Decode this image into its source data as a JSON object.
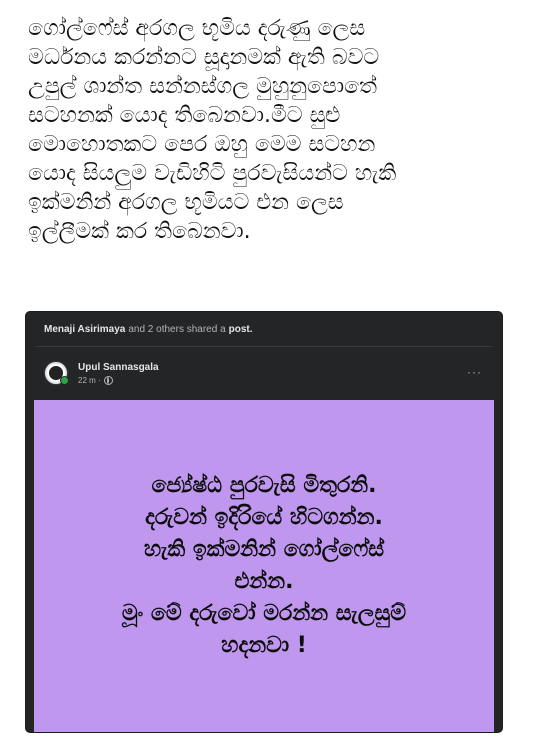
{
  "article": {
    "lines": [
      "ගෝල්ෆේස් අරගල භූමිය දරුණු ලෙස",
      "මර්ධනය කරන්නට සූදානමක් ඇති බවට",
      "උපුල් ශාන්ත සන්නස්ගල මුහුනුපොතේ",
      "සටහනක් යොද තිබෙනවා.මීට සුළු",
      "මොහොතකට පෙර ඔහු මෙම සටහන",
      "යොද සියලුම වැඩිහිටි පුරවැසියන්ට හැකි",
      "ඉක්මනින් අරගල භූමියට එන ලෙස",
      "ඉල්ලීමක් කර තිබෙනවා."
    ]
  },
  "shared": {
    "sharer_name": "Menaji Asirimaya",
    "middle_text": "and 2 others shared a",
    "object_text": "post."
  },
  "post": {
    "author": "Upul Sannasgala",
    "time": "22 m ·",
    "more_label": "···",
    "body_lines": [
      "ජ්‍යේෂ්ඨ පුරවැසි මිතුරනි.",
      "දරුවන් ඉදිරියේ හිටගන්න.",
      "හැකි ඉක්මනින් ගෝල්ෆේස්",
      "එන්න.",
      "මූං මේ දරුවෝ මරන්න සැලසුම්",
      "හදනවා !"
    ],
    "background_color": "#bf97ef"
  },
  "icons": {
    "avatar": "profile-avatar",
    "privacy": "globe-icon",
    "more": "more-horizontal-icon"
  }
}
